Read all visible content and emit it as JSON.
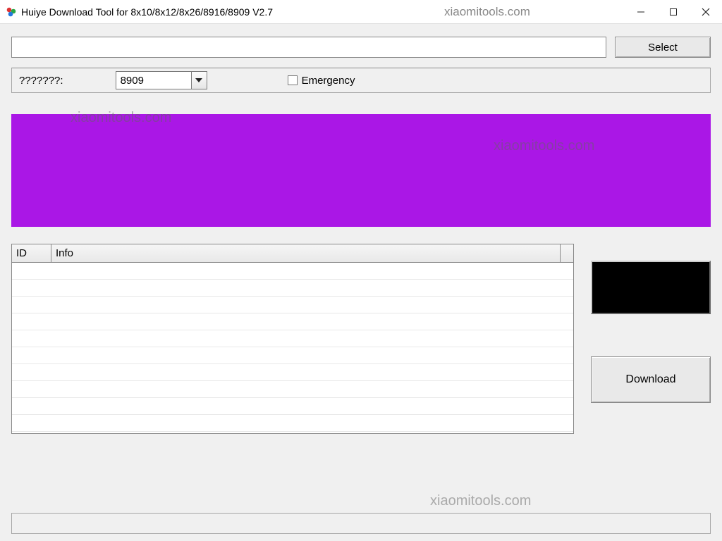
{
  "titlebar": {
    "title": "Huiye Download Tool for 8x10/8x12/8x26/8916/8909 V2.7",
    "watermark": "xiaomitools.com"
  },
  "toolbar": {
    "file_path_value": "",
    "select_label": "Select"
  },
  "options": {
    "platform_label": "???????:",
    "platform_value": "8909",
    "emergency_label": "Emergency",
    "emergency_checked": false
  },
  "table": {
    "columns": {
      "id": "ID",
      "info": "Info"
    },
    "rows": [
      {
        "id": "",
        "info": ""
      },
      {
        "id": "",
        "info": ""
      },
      {
        "id": "",
        "info": ""
      },
      {
        "id": "",
        "info": ""
      },
      {
        "id": "",
        "info": ""
      },
      {
        "id": "",
        "info": ""
      },
      {
        "id": "",
        "info": ""
      },
      {
        "id": "",
        "info": ""
      },
      {
        "id": "",
        "info": ""
      },
      {
        "id": "",
        "info": ""
      }
    ]
  },
  "actions": {
    "download_label": "Download"
  },
  "statusbar": {
    "text": ""
  },
  "watermarks": {
    "wm1": "xiaomitools.com",
    "wm2": "xiaomitools.com",
    "wm3": "xiaomitools.com"
  },
  "colors": {
    "banner": "#aa17e6"
  }
}
